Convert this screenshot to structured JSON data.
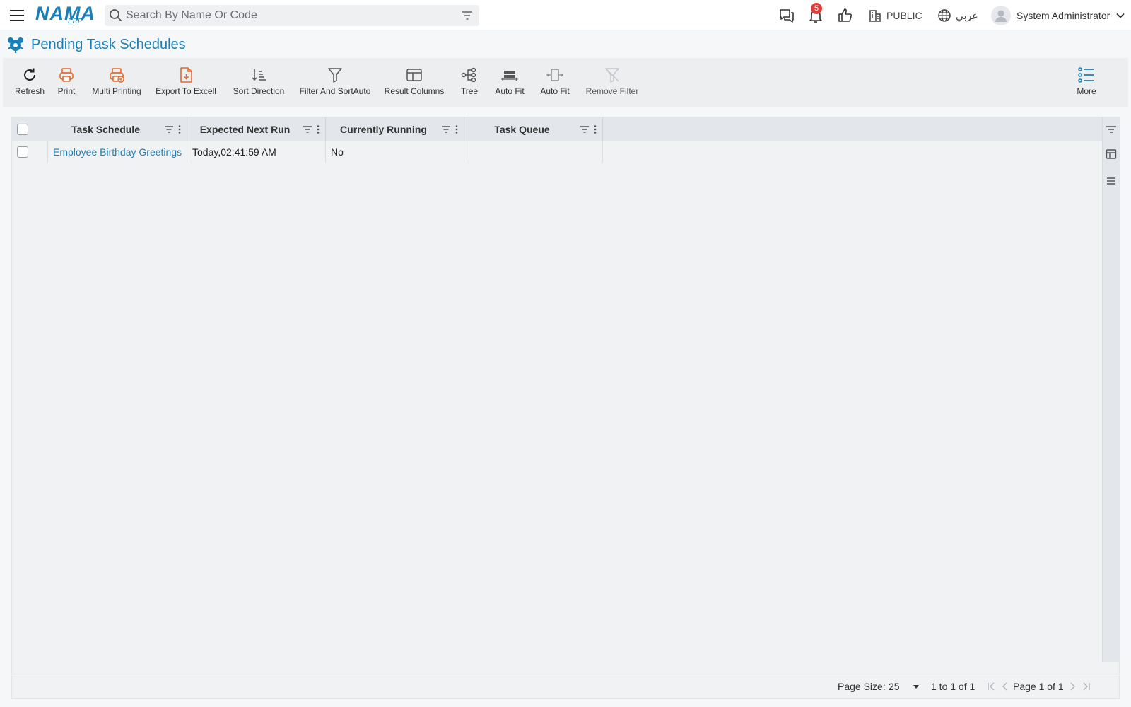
{
  "app": {
    "logo_text": "NAMA",
    "logo_sub": "ERP"
  },
  "header": {
    "search_placeholder": "Search By Name Or Code",
    "notification_count": "5",
    "branch": "PUBLIC",
    "language": "عربي",
    "user_name": "System Administrator"
  },
  "page": {
    "title": "Pending Task Schedules"
  },
  "toolbar": {
    "refresh": "Refresh",
    "print": "Print",
    "multi_printing": "Multi Printing",
    "export_excel": "Export To Excell",
    "sort_direction": "Sort Direction",
    "filter_sort_auto": "Filter And SortAuto",
    "result_columns": "Result Columns",
    "tree": "Tree",
    "auto_fit_1": "Auto Fit",
    "auto_fit_2": "Auto Fit",
    "remove_filter": "Remove Filter",
    "more": "More"
  },
  "grid": {
    "columns": [
      "Task Schedule",
      "Expected Next Run",
      "Currently Running",
      "Task Queue"
    ],
    "rows": [
      {
        "task_schedule": "Employee Birthday Greetings",
        "expected_next_run": "Today,02:41:59 AM",
        "currently_running": "No",
        "task_queue": ""
      }
    ]
  },
  "pagination": {
    "page_size_label": "Page Size:",
    "page_size": "25",
    "range": "1 to 1 of 1",
    "page_info": "Page 1 of 1"
  },
  "colors": {
    "brand": "#1a7fb8",
    "accent_orange": "#e8692a",
    "badge": "#e23b3b"
  }
}
